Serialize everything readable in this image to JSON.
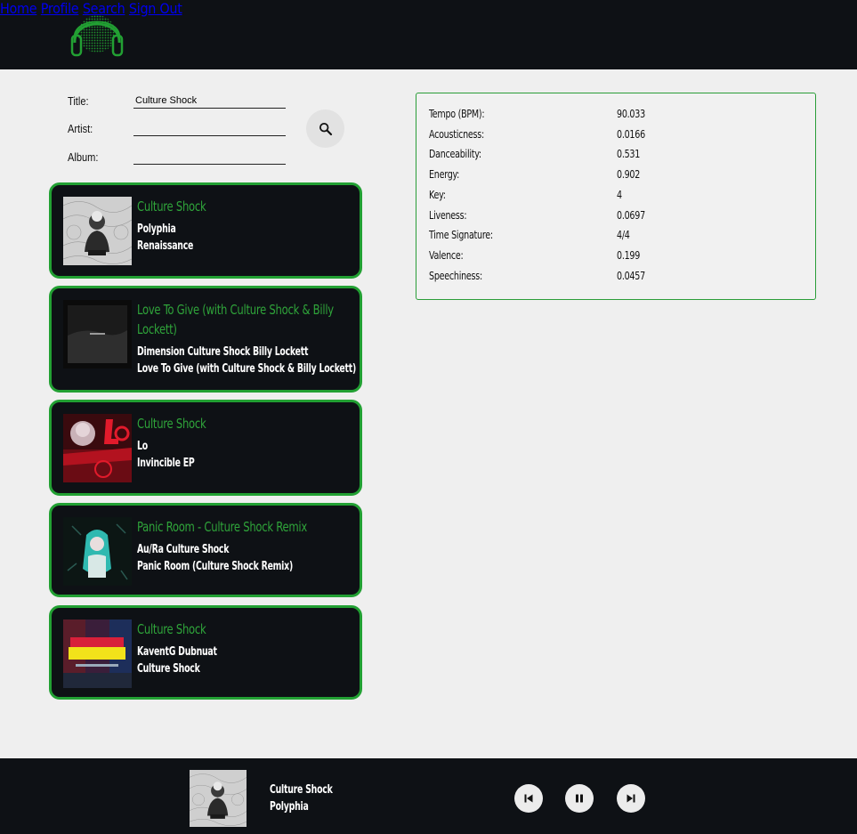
{
  "nav": {
    "home": "Home",
    "profile": "Profile",
    "search": "Search",
    "sign_out": "Sign Out"
  },
  "search_form": {
    "title_label": "Title:",
    "title_value": "Culture Shock",
    "artist_label": "Artist:",
    "artist_value": "",
    "album_label": "Album:",
    "album_value": ""
  },
  "results": [
    {
      "title": "Culture Shock",
      "artist": "Polyphia",
      "album": "Renaissance"
    },
    {
      "title": "Love To Give (with Culture Shock & Billy Lockett)",
      "artist": "Dimension Culture Shock Billy Lockett",
      "album": "Love To Give (with Culture Shock & Billy Lockett)"
    },
    {
      "title": "Culture Shock",
      "artist": "Lo",
      "album": "Invincible EP"
    },
    {
      "title": "Panic Room - Culture Shock Remix",
      "artist": "Au/Ra Culture Shock",
      "album": "Panic Room (Culture Shock Remix)"
    },
    {
      "title": "Culture Shock",
      "artist": "KaventG Dubnuat",
      "album": "Culture Shock"
    }
  ],
  "features": [
    {
      "label": "Tempo (BPM):",
      "value": "90.033"
    },
    {
      "label": "Acousticness:",
      "value": "0.0166"
    },
    {
      "label": "Danceability:",
      "value": "0.531"
    },
    {
      "label": "Energy:",
      "value": "0.902"
    },
    {
      "label": "Key:",
      "value": "4"
    },
    {
      "label": "Liveness:",
      "value": "0.0697"
    },
    {
      "label": "Time Signature:",
      "value": "4/4"
    },
    {
      "label": "Valence:",
      "value": "0.199"
    },
    {
      "label": "Speechiness:",
      "value": "0.0457"
    }
  ],
  "player": {
    "title": "Culture Shock",
    "artist": "Polyphia"
  },
  "icons": {
    "logo": "headphones-logo-icon",
    "search": "magnifier-icon",
    "prev": "skip-previous-icon",
    "pause": "pause-icon",
    "next": "skip-next-icon"
  },
  "colors": {
    "accent_green": "#2fa43a",
    "dark_bg": "#0e1115",
    "page_bg": "#efefef"
  }
}
